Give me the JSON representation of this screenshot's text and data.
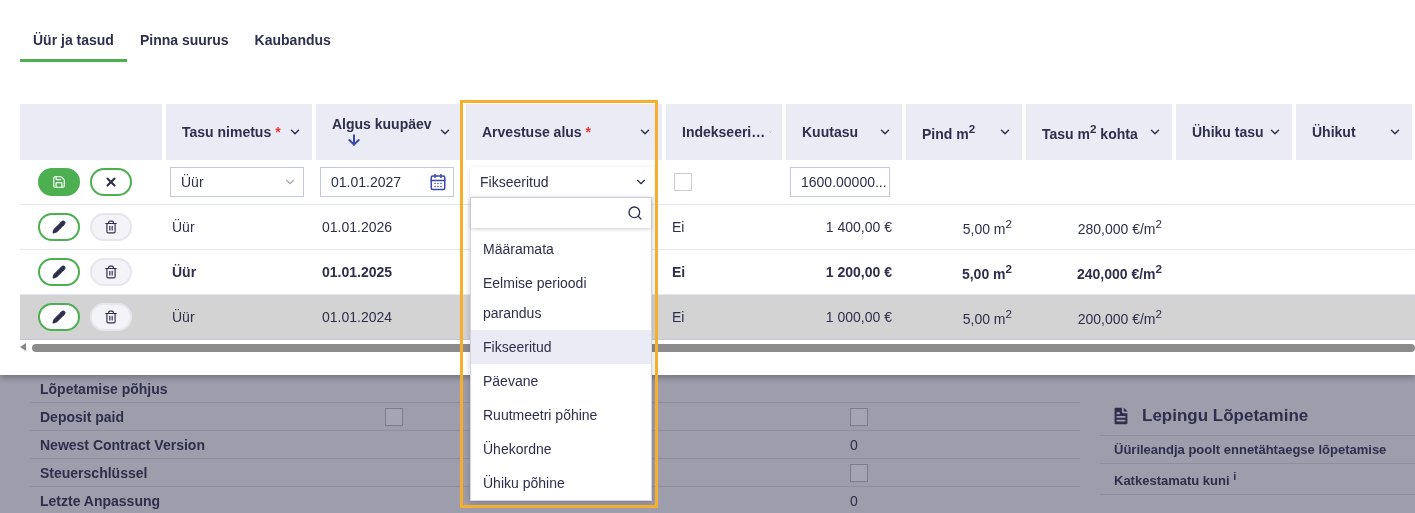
{
  "tabs": [
    {
      "label": "Üür ja tasud",
      "selected": true
    },
    {
      "label": "Pinna suurus",
      "selected": false
    },
    {
      "label": "Kaubandus",
      "selected": false
    }
  ],
  "table": {
    "columns": [
      {
        "label": "Tasu nimetus",
        "required_mark": "*",
        "sorted": false
      },
      {
        "label": "Algus kuupäev",
        "sorted": true
      },
      {
        "label": "Arvestuse alus",
        "required_mark": "*",
        "sorted": false,
        "highlighted": true
      },
      {
        "label": "Indekseeri…",
        "sorted": false
      },
      {
        "label": "Kuutasu",
        "sorted": false
      },
      {
        "label": "Pind m$^{2}$",
        "sorted": false
      },
      {
        "label": "Tasu m$^{2}$ kohta",
        "sorted": false
      },
      {
        "label": "Ühiku tasu",
        "sorted": false
      },
      {
        "label": "Ühikut",
        "sorted": false
      }
    ],
    "edit_row": {
      "name": "Üür",
      "start_date": "01.01.2027",
      "basis": "Fikseeritud",
      "basis_expanded": true,
      "indexed_checked": false,
      "monthly_fee": "1600.00000..."
    },
    "rows": [
      {
        "name": "Üür",
        "start_date": "01.01.2026",
        "indexed": "Ei",
        "monthly_fee": "1 400,00 €",
        "area": "5,00 m$^{2}$",
        "fee_per_m2": "280,000 €/m$^{2}$",
        "bold": false,
        "selected": false
      },
      {
        "name": "Üür",
        "start_date": "01.01.2025",
        "indexed": "Ei",
        "monthly_fee": "1 200,00 €",
        "area": "5,00 m$^{2}$",
        "fee_per_m2": "240,000 €/m$^{2}$",
        "bold": true,
        "selected": false
      },
      {
        "name": "Üür",
        "start_date": "01.01.2024",
        "indexed": "Ei",
        "monthly_fee": "1 000,00 €",
        "area": "5,00 m$^{2}$",
        "fee_per_m2": "200,000 €/m$^{2}$",
        "bold": false,
        "selected": true
      }
    ]
  },
  "dropdown": {
    "options": [
      {
        "label": "Määramata",
        "selected": false
      },
      {
        "label": "Eelmise perioodi parandus",
        "selected": false
      },
      {
        "label": "Fikseeritud",
        "selected": true
      },
      {
        "label": "Päevane",
        "selected": false
      },
      {
        "label": "Ruutmeetri põhine",
        "selected": false
      },
      {
        "label": "Ühekordne",
        "selected": false
      },
      {
        "label": "Ühiku põhine",
        "selected": false
      }
    ]
  },
  "details": [
    {
      "label": "Lõpetamise põhjus",
      "value": {
        "kind": "none"
      },
      "other": {
        "kind": "none"
      }
    },
    {
      "label": "Deposit paid",
      "value": {
        "kind": "checkbox",
        "checked": false
      },
      "other": {
        "kind": "checkbox",
        "checked": false
      }
    },
    {
      "label": "Newest Contract Version",
      "value": {
        "kind": "none"
      },
      "other": {
        "kind": "text",
        "text": "0"
      }
    },
    {
      "label": "Steuerschlüssel",
      "value": {
        "kind": "none"
      },
      "other": {
        "kind": "checkbox",
        "checked": false
      }
    },
    {
      "label": "Letzte Anpassung",
      "value": {
        "kind": "none"
      },
      "other": {
        "kind": "text",
        "text": "0"
      }
    }
  ],
  "termination": {
    "title": "Lepingu Lõpetamine",
    "items": [
      "Üürileandja poolt ennetähtaegse lõpetamise",
      "Katkestamatu kuni $^{i}$"
    ]
  }
}
